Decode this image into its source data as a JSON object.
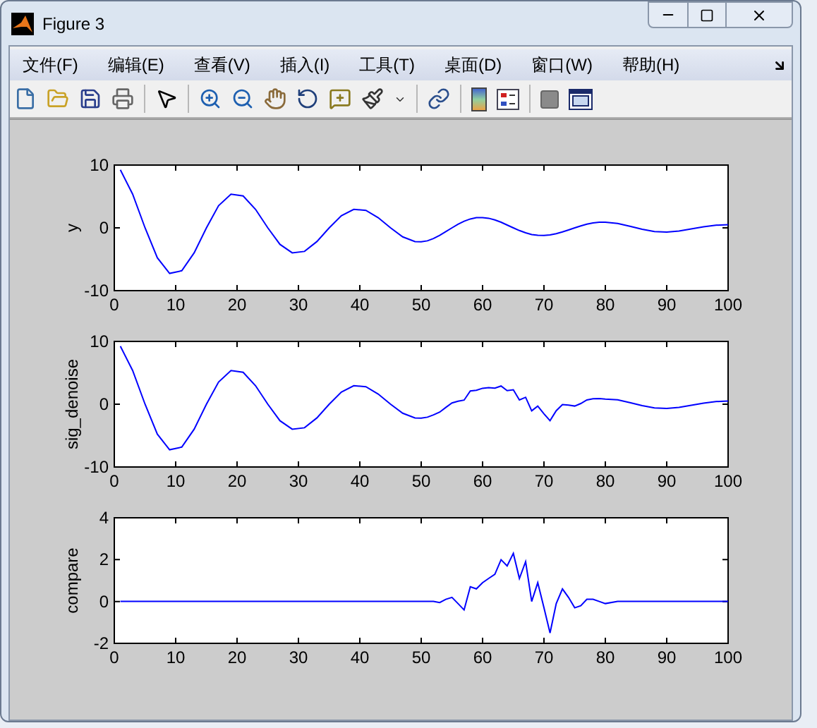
{
  "window": {
    "title": "Figure 3"
  },
  "menu": [
    "文件(F)",
    "编辑(E)",
    "查看(V)",
    "插入(I)",
    "工具(T)",
    "桌面(D)",
    "窗口(W)",
    "帮助(H)"
  ],
  "plots": [
    {
      "chart_data": {
        "type": "line",
        "ylabel": "y",
        "xlim": [
          0,
          100
        ],
        "ylim": [
          -10,
          10
        ],
        "xticks": [
          0,
          10,
          20,
          30,
          40,
          50,
          60,
          70,
          80,
          90,
          100
        ],
        "yticks": [
          -10,
          0,
          10
        ],
        "x": [
          1,
          3,
          5,
          7,
          9,
          11,
          13,
          15,
          17,
          19,
          21,
          23,
          25,
          27,
          29,
          31,
          33,
          35,
          37,
          39,
          41,
          43,
          45,
          47,
          49,
          50,
          51,
          52,
          53,
          54,
          55,
          56,
          57,
          58,
          59,
          60,
          61,
          62,
          63,
          64,
          65,
          66,
          67,
          68,
          69,
          70,
          71,
          72,
          73,
          74,
          75,
          76,
          77,
          78,
          79,
          80,
          82,
          84,
          86,
          88,
          90,
          92,
          94,
          96,
          98,
          100
        ],
        "series": [
          {
            "color": "#0000ff",
            "values": [
              9.23,
              5.37,
              0,
              -4.76,
              -7.26,
              -6.84,
              -3.98,
              0,
              3.53,
              5.38,
              5.07,
              2.95,
              0,
              -2.62,
              -3.98,
              -3.75,
              -2.18,
              0,
              1.94,
              2.95,
              2.78,
              1.62,
              0,
              -1.43,
              -2.19,
              -2.23,
              -2.06,
              -1.7,
              -1.2,
              -0.61,
              0,
              0.58,
              1.06,
              1.42,
              1.62,
              1.65,
              1.53,
              1.26,
              0.89,
              0.45,
              0,
              -0.43,
              -0.79,
              -1.05,
              -1.2,
              -1.22,
              -1.13,
              -0.93,
              -0.66,
              -0.34,
              0,
              0.32,
              0.58,
              0.78,
              0.89,
              0.91,
              0.69,
              0.25,
              -0.23,
              -0.58,
              -0.67,
              -0.51,
              -0.18,
              0.17,
              0.43,
              0.5
            ]
          }
        ]
      }
    },
    {
      "chart_data": {
        "type": "line",
        "ylabel": "sig_denoise",
        "xlim": [
          0,
          100
        ],
        "ylim": [
          -10,
          10
        ],
        "xticks": [
          0,
          10,
          20,
          30,
          40,
          50,
          60,
          70,
          80,
          90,
          100
        ],
        "yticks": [
          -10,
          0,
          10
        ],
        "x": [
          1,
          3,
          5,
          7,
          9,
          11,
          13,
          15,
          17,
          19,
          21,
          23,
          25,
          27,
          29,
          31,
          33,
          35,
          37,
          39,
          41,
          43,
          45,
          47,
          49,
          50,
          51,
          52,
          53,
          54,
          55,
          56,
          57,
          58,
          59,
          60,
          61,
          62,
          63,
          64,
          65,
          66,
          67,
          68,
          69,
          70,
          71,
          72,
          73,
          74,
          75,
          76,
          77,
          78,
          79,
          80,
          82,
          84,
          86,
          88,
          90,
          92,
          94,
          96,
          98,
          100
        ],
        "series": [
          {
            "color": "#0000ff",
            "values": [
              9.23,
              5.37,
              0,
              -4.76,
              -7.26,
              -6.84,
              -3.98,
              0,
              3.53,
              5.38,
              5.07,
              2.95,
              0,
              -2.62,
              -3.98,
              -3.75,
              -2.18,
              0,
              1.94,
              2.95,
              2.78,
              1.62,
              0,
              -1.43,
              -2.19,
              -2.23,
              -2.06,
              -1.7,
              -1.25,
              -0.51,
              0.2,
              0.48,
              0.66,
              2.12,
              2.22,
              2.55,
              2.63,
              2.56,
              2.89,
              2.15,
              2.3,
              0.67,
              1.11,
              -1.05,
              -0.3,
              -1.52,
              -2.63,
              -1.03,
              -0.06,
              -0.14,
              -0.3,
              0.12,
              0.68,
              0.88,
              0.89,
              0.81,
              0.69,
              0.25,
              -0.23,
              -0.58,
              -0.67,
              -0.51,
              -0.18,
              0.17,
              0.43,
              0.5
            ]
          }
        ]
      }
    },
    {
      "chart_data": {
        "type": "line",
        "ylabel": "compare",
        "xlim": [
          0,
          100
        ],
        "ylim": [
          -2,
          4
        ],
        "xticks": [
          0,
          10,
          20,
          30,
          40,
          50,
          60,
          70,
          80,
          90,
          100
        ],
        "yticks": [
          -2,
          0,
          2,
          4
        ],
        "x": [
          1,
          3,
          5,
          7,
          9,
          11,
          13,
          15,
          17,
          19,
          21,
          23,
          25,
          27,
          29,
          31,
          33,
          35,
          37,
          39,
          41,
          43,
          45,
          47,
          49,
          50,
          51,
          52,
          53,
          54,
          55,
          56,
          57,
          58,
          59,
          60,
          61,
          62,
          63,
          64,
          65,
          66,
          67,
          68,
          69,
          70,
          71,
          72,
          73,
          74,
          75,
          76,
          77,
          78,
          79,
          80,
          82,
          84,
          86,
          88,
          90,
          92,
          94,
          96,
          98,
          100
        ],
        "series": [
          {
            "color": "#0000ff",
            "values": [
              0,
              0,
              0,
              0,
              0,
              0,
              0,
              0,
              0,
              0,
              0,
              0,
              0,
              0,
              0,
              0,
              0,
              0,
              0,
              0,
              0,
              0,
              0,
              0,
              0,
              0,
              0,
              0,
              -0.05,
              0.1,
              0.2,
              -0.1,
              -0.4,
              0.7,
              0.6,
              0.9,
              1.1,
              1.3,
              2.0,
              1.7,
              2.3,
              1.1,
              1.9,
              0,
              0.9,
              -0.3,
              -1.5,
              -0.1,
              0.6,
              0.2,
              -0.3,
              -0.2,
              0.1,
              0.1,
              0,
              -0.1,
              0,
              0,
              0,
              0,
              0,
              0,
              0,
              0,
              0,
              0
            ]
          }
        ]
      }
    }
  ]
}
